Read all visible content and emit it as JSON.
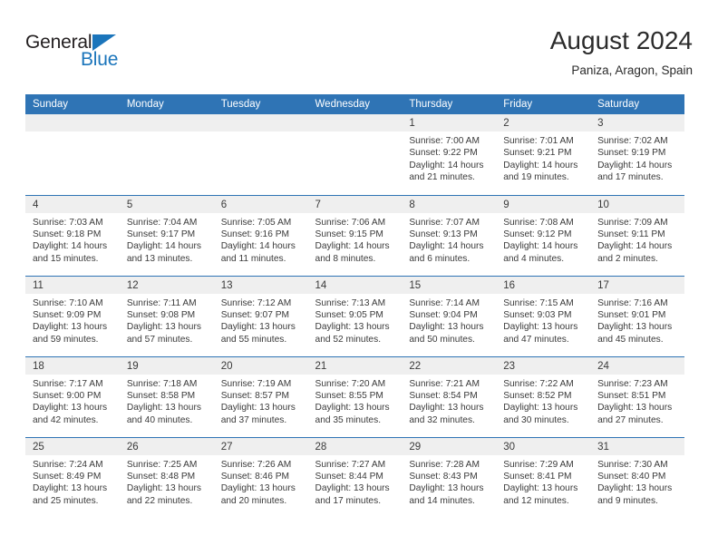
{
  "logo": {
    "word_one": "General",
    "word_two": "Blue",
    "triangle_icon": "blue-triangle-icon",
    "brand_color": "#1b75bb"
  },
  "header": {
    "title": "August 2024",
    "subtitle": "Paniza, Aragon, Spain"
  },
  "theme": {
    "header_blue": "#2f74b5",
    "day_band_gray": "#efefef",
    "text": "#3a3a3a"
  },
  "calendar": {
    "weekdays": [
      "Sunday",
      "Monday",
      "Tuesday",
      "Wednesday",
      "Thursday",
      "Friday",
      "Saturday"
    ],
    "weeks": [
      [
        {
          "day": "",
          "lines": []
        },
        {
          "day": "",
          "lines": []
        },
        {
          "day": "",
          "lines": []
        },
        {
          "day": "",
          "lines": []
        },
        {
          "day": "1",
          "lines": [
            "Sunrise: 7:00 AM",
            "Sunset: 9:22 PM",
            "Daylight: 14 hours and 21 minutes."
          ]
        },
        {
          "day": "2",
          "lines": [
            "Sunrise: 7:01 AM",
            "Sunset: 9:21 PM",
            "Daylight: 14 hours and 19 minutes."
          ]
        },
        {
          "day": "3",
          "lines": [
            "Sunrise: 7:02 AM",
            "Sunset: 9:19 PM",
            "Daylight: 14 hours and 17 minutes."
          ]
        }
      ],
      [
        {
          "day": "4",
          "lines": [
            "Sunrise: 7:03 AM",
            "Sunset: 9:18 PM",
            "Daylight: 14 hours and 15 minutes."
          ]
        },
        {
          "day": "5",
          "lines": [
            "Sunrise: 7:04 AM",
            "Sunset: 9:17 PM",
            "Daylight: 14 hours and 13 minutes."
          ]
        },
        {
          "day": "6",
          "lines": [
            "Sunrise: 7:05 AM",
            "Sunset: 9:16 PM",
            "Daylight: 14 hours and 11 minutes."
          ]
        },
        {
          "day": "7",
          "lines": [
            "Sunrise: 7:06 AM",
            "Sunset: 9:15 PM",
            "Daylight: 14 hours and 8 minutes."
          ]
        },
        {
          "day": "8",
          "lines": [
            "Sunrise: 7:07 AM",
            "Sunset: 9:13 PM",
            "Daylight: 14 hours and 6 minutes."
          ]
        },
        {
          "day": "9",
          "lines": [
            "Sunrise: 7:08 AM",
            "Sunset: 9:12 PM",
            "Daylight: 14 hours and 4 minutes."
          ]
        },
        {
          "day": "10",
          "lines": [
            "Sunrise: 7:09 AM",
            "Sunset: 9:11 PM",
            "Daylight: 14 hours and 2 minutes."
          ]
        }
      ],
      [
        {
          "day": "11",
          "lines": [
            "Sunrise: 7:10 AM",
            "Sunset: 9:09 PM",
            "Daylight: 13 hours and 59 minutes."
          ]
        },
        {
          "day": "12",
          "lines": [
            "Sunrise: 7:11 AM",
            "Sunset: 9:08 PM",
            "Daylight: 13 hours and 57 minutes."
          ]
        },
        {
          "day": "13",
          "lines": [
            "Sunrise: 7:12 AM",
            "Sunset: 9:07 PM",
            "Daylight: 13 hours and 55 minutes."
          ]
        },
        {
          "day": "14",
          "lines": [
            "Sunrise: 7:13 AM",
            "Sunset: 9:05 PM",
            "Daylight: 13 hours and 52 minutes."
          ]
        },
        {
          "day": "15",
          "lines": [
            "Sunrise: 7:14 AM",
            "Sunset: 9:04 PM",
            "Daylight: 13 hours and 50 minutes."
          ]
        },
        {
          "day": "16",
          "lines": [
            "Sunrise: 7:15 AM",
            "Sunset: 9:03 PM",
            "Daylight: 13 hours and 47 minutes."
          ]
        },
        {
          "day": "17",
          "lines": [
            "Sunrise: 7:16 AM",
            "Sunset: 9:01 PM",
            "Daylight: 13 hours and 45 minutes."
          ]
        }
      ],
      [
        {
          "day": "18",
          "lines": [
            "Sunrise: 7:17 AM",
            "Sunset: 9:00 PM",
            "Daylight: 13 hours and 42 minutes."
          ]
        },
        {
          "day": "19",
          "lines": [
            "Sunrise: 7:18 AM",
            "Sunset: 8:58 PM",
            "Daylight: 13 hours and 40 minutes."
          ]
        },
        {
          "day": "20",
          "lines": [
            "Sunrise: 7:19 AM",
            "Sunset: 8:57 PM",
            "Daylight: 13 hours and 37 minutes."
          ]
        },
        {
          "day": "21",
          "lines": [
            "Sunrise: 7:20 AM",
            "Sunset: 8:55 PM",
            "Daylight: 13 hours and 35 minutes."
          ]
        },
        {
          "day": "22",
          "lines": [
            "Sunrise: 7:21 AM",
            "Sunset: 8:54 PM",
            "Daylight: 13 hours and 32 minutes."
          ]
        },
        {
          "day": "23",
          "lines": [
            "Sunrise: 7:22 AM",
            "Sunset: 8:52 PM",
            "Daylight: 13 hours and 30 minutes."
          ]
        },
        {
          "day": "24",
          "lines": [
            "Sunrise: 7:23 AM",
            "Sunset: 8:51 PM",
            "Daylight: 13 hours and 27 minutes."
          ]
        }
      ],
      [
        {
          "day": "25",
          "lines": [
            "Sunrise: 7:24 AM",
            "Sunset: 8:49 PM",
            "Daylight: 13 hours and 25 minutes."
          ]
        },
        {
          "day": "26",
          "lines": [
            "Sunrise: 7:25 AM",
            "Sunset: 8:48 PM",
            "Daylight: 13 hours and 22 minutes."
          ]
        },
        {
          "day": "27",
          "lines": [
            "Sunrise: 7:26 AM",
            "Sunset: 8:46 PM",
            "Daylight: 13 hours and 20 minutes."
          ]
        },
        {
          "day": "28",
          "lines": [
            "Sunrise: 7:27 AM",
            "Sunset: 8:44 PM",
            "Daylight: 13 hours and 17 minutes."
          ]
        },
        {
          "day": "29",
          "lines": [
            "Sunrise: 7:28 AM",
            "Sunset: 8:43 PM",
            "Daylight: 13 hours and 14 minutes."
          ]
        },
        {
          "day": "30",
          "lines": [
            "Sunrise: 7:29 AM",
            "Sunset: 8:41 PM",
            "Daylight: 13 hours and 12 minutes."
          ]
        },
        {
          "day": "31",
          "lines": [
            "Sunrise: 7:30 AM",
            "Sunset: 8:40 PM",
            "Daylight: 13 hours and 9 minutes."
          ]
        }
      ]
    ]
  }
}
